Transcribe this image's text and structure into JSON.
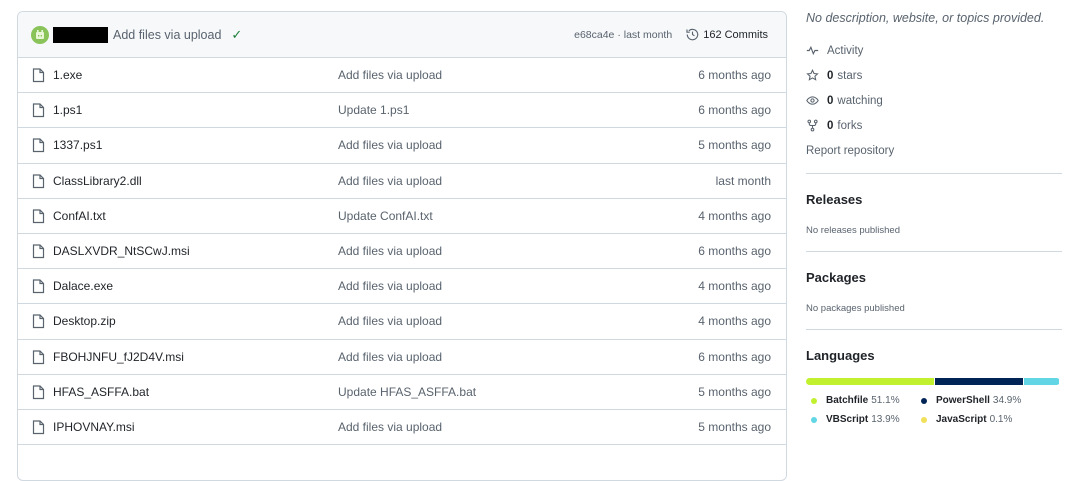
{
  "latest_commit": {
    "message": "Add files via upload",
    "hash": "e68ca4e",
    "separator": "·",
    "when": "last month",
    "commits_label": "162 Commits"
  },
  "files": [
    {
      "name": "1.exe",
      "commit": "Add files via upload",
      "age": "6 months ago"
    },
    {
      "name": "1.ps1",
      "commit": "Update 1.ps1",
      "age": "6 months ago"
    },
    {
      "name": "1337.ps1",
      "commit": "Add files via upload",
      "age": "5 months ago"
    },
    {
      "name": "ClassLibrary2.dll",
      "commit": "Add files via upload",
      "age": "last month"
    },
    {
      "name": "ConfAI.txt",
      "commit": "Update ConfAI.txt",
      "age": "4 months ago"
    },
    {
      "name": "DASLXVDR_NtSCwJ.msi",
      "commit": "Add files via upload",
      "age": "6 months ago"
    },
    {
      "name": "Dalace.exe",
      "commit": "Add files via upload",
      "age": "4 months ago"
    },
    {
      "name": "Desktop.zip",
      "commit": "Add files via upload",
      "age": "4 months ago"
    },
    {
      "name": "FBOHJNFU_fJ2D4V.msi",
      "commit": "Add files via upload",
      "age": "6 months ago"
    },
    {
      "name": "HFAS_ASFFA.bat",
      "commit": "Update HFAS_ASFFA.bat",
      "age": "5 months ago"
    },
    {
      "name": "IPHOVNAY.msi",
      "commit": "Add files via upload",
      "age": "5 months ago"
    }
  ],
  "about": {
    "description": "No description, website, or topics provided.",
    "activity_label": "Activity",
    "stars_count": "0",
    "stars_label": "stars",
    "watching_count": "0",
    "watching_label": "watching",
    "forks_count": "0",
    "forks_label": "forks",
    "report_label": "Report repository"
  },
  "releases": {
    "title": "Releases",
    "empty": "No releases published"
  },
  "packages": {
    "title": "Packages",
    "empty": "No packages published"
  },
  "languages": {
    "title": "Languages",
    "items": [
      {
        "name": "Batchfile",
        "percent": "51.1%",
        "value": 51.1,
        "color": "#c1f12e"
      },
      {
        "name": "PowerShell",
        "percent": "34.9%",
        "value": 34.9,
        "color": "#012456"
      },
      {
        "name": "VBScript",
        "percent": "13.9%",
        "value": 13.9,
        "color": "#63d6e6"
      },
      {
        "name": "JavaScript",
        "percent": "0.1%",
        "value": 0.1,
        "color": "#f1e05a"
      }
    ]
  },
  "icons": {
    "avatar": "user-avatar-icon",
    "check": "check-icon",
    "history": "history-icon",
    "file": "file-icon",
    "activity": "pulse-icon",
    "star": "star-icon",
    "eye": "eye-icon",
    "fork": "repo-forked-icon"
  }
}
